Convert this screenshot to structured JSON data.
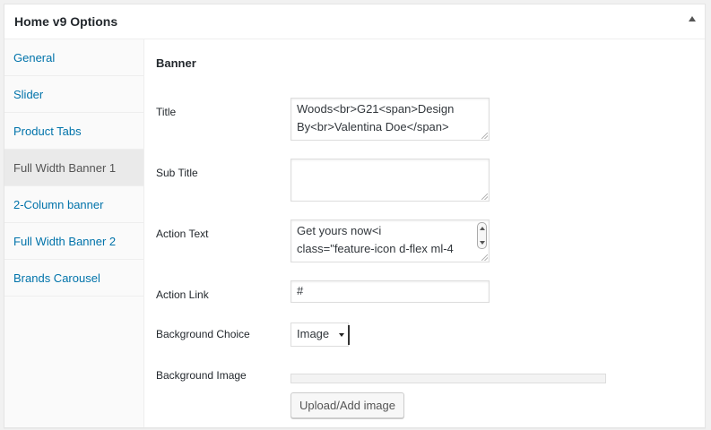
{
  "panel": {
    "title": "Home v9 Options"
  },
  "sidebar": {
    "items": [
      {
        "label": "General"
      },
      {
        "label": "Slider"
      },
      {
        "label": "Product Tabs"
      },
      {
        "label": "Full Width Banner 1",
        "active": true
      },
      {
        "label": "2-Column banner"
      },
      {
        "label": "Full Width Banner 2"
      },
      {
        "label": "Brands Carousel"
      }
    ]
  },
  "banner": {
    "section_title": "Banner",
    "title": {
      "label": "Title",
      "line1": "Woods<br>G21<span>Design",
      "line2": "By<br>Valentina Doe</span>"
    },
    "sub_title": {
      "label": "Sub Title",
      "value": ""
    },
    "action_text": {
      "label": "Action Text",
      "line1": "Get yours now<i",
      "line2": "class=\"feature-icon d-flex ml-4"
    },
    "action_link": {
      "label": "Action Link",
      "value": "#"
    },
    "background_choice": {
      "label": "Background Choice",
      "selected": "Image"
    },
    "background_image": {
      "label": "Background Image",
      "button_label": "Upload/Add image"
    }
  },
  "colors": {
    "link": "#0073aa",
    "active_bg": "#eaeaea"
  }
}
